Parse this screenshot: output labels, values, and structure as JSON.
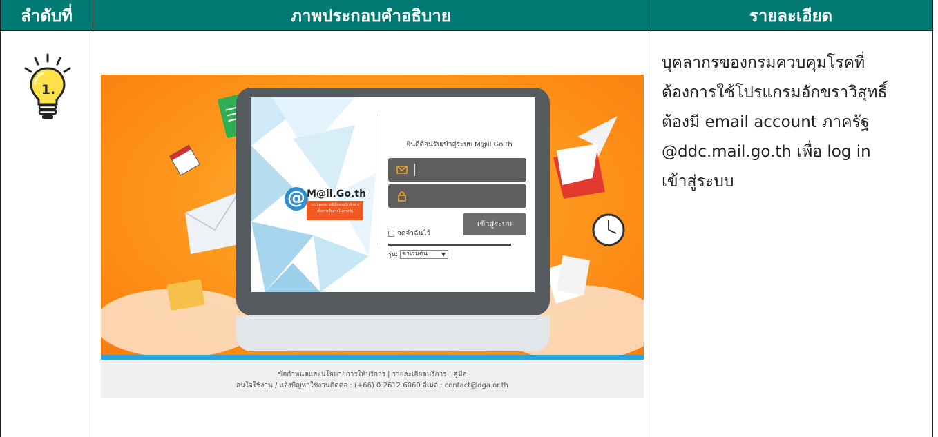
{
  "header": {
    "col1": "ลำดับที่",
    "col2": "ภาพประกอบคำอธิบาย",
    "col3": "รายละเอียด"
  },
  "step": {
    "number": "1."
  },
  "screenshot": {
    "welcome": "ยินดีต้อนรับเข้าสู่ระบบ M@il.Go.th",
    "logo_symbol": "@",
    "logo_text": "M@il.Go.th",
    "logo_tagline": "ระบบจดหมายอิเล็กทรอนิกส์กลาง เพื่อการสื่อสารในภาครัฐ",
    "remember_label": "จดจำฉันไว้",
    "login_button": "เข้าสู่ระบบ",
    "version_label": "รุ่น:",
    "version_value": "ค่าเริ่มต้น",
    "footer_line1": "ข้อกำหนดและนโยบายการให้บริการ | รายละเอียดบริการ | คู่มือ",
    "footer_line2": "สนใจใช้งาน / แจ้งปัญหาใช้งานติดต่อ : (+66) 0 2612 6060 อีเมล์ : contact@dga.or.th"
  },
  "description": {
    "lines": [
      "บุคลากรของกรมควบคุมโรคที่",
      "ต้องการใช้โปรแกรมอักขราวิสุทธิ์",
      "ต้องมี  email account ภาครัฐ",
      "@ddc.mail.go.th เพื่อ  log in",
      "เข้าสู่ระบบ"
    ]
  },
  "colors": {
    "header_bg": "#007a72",
    "header_text": "#ffffff",
    "orange_bg": "#f98c17",
    "bulb_yellow": "#ffe14a"
  }
}
